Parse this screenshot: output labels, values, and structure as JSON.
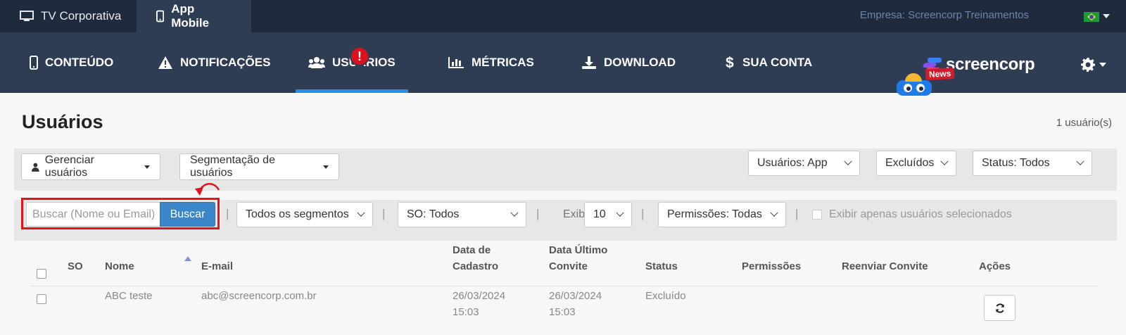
{
  "topbar": {
    "tabs": [
      {
        "label": "TV Corporativa",
        "icon": "monitor-icon"
      },
      {
        "label": "App Mobile",
        "icon": "mobile-icon",
        "active": true
      }
    ],
    "company": "Empresa: Screencorp Treinamentos",
    "language_flag": "brazil-flag-icon"
  },
  "nav": {
    "items": [
      {
        "label": "CONTEÚDO",
        "icon": "mobile-icon"
      },
      {
        "label": "NOTIFICAÇÕES",
        "icon": "warning-icon"
      },
      {
        "label": "USUÁRIOS",
        "icon": "users-icon",
        "active": true
      },
      {
        "label": "MÉTRICAS",
        "icon": "bar-chart-icon"
      },
      {
        "label": "DOWNLOAD",
        "icon": "download-icon"
      },
      {
        "label": "SUA CONTA",
        "icon": "dollar-icon"
      }
    ],
    "alert_badge": "!",
    "brand": "screencorp",
    "news_badge": "News",
    "settings_icon": "gear-icon"
  },
  "colors": {
    "topbar_bg": "#1f2a3d",
    "nav_bg": "#2f3d54",
    "active_underline": "#2690e8",
    "alert_red": "#d9121f",
    "search_button": "#3a86c8",
    "highlight_red": "#e0141a"
  },
  "page": {
    "title": "Usuários",
    "count": "1 usuário(s)"
  },
  "toolbar": {
    "manage_users": "Gerenciar usuários",
    "segmentation": "Segmentação de usuários",
    "users_filter": "Usuários: App",
    "excluded_filter": "Excluídos",
    "status_filter": "Status: Todos"
  },
  "filters": {
    "search_placeholder": "Buscar (Nome ou Email)",
    "search_button": "Buscar",
    "segments": "Todos os segmentos",
    "os": "SO: Todos",
    "show_label": "Exibir",
    "show_value": "10",
    "permissions": "Permissões: Todas",
    "only_selected": "Exibir apenas usuários selecionados",
    "separator": "|"
  },
  "table": {
    "headers": {
      "so": "SO",
      "name": "Nome",
      "email": "E-mail",
      "created_1": "Data de",
      "created_2": "Cadastro",
      "invite_1": "Data Último",
      "invite_2": "Convite",
      "status": "Status",
      "permissions": "Permissões",
      "resend": "Reenviar Convite",
      "actions": "Ações"
    },
    "rows": [
      {
        "so": "",
        "name": "ABC teste",
        "email": "abc@screencorp.com.br",
        "created_date": "26/03/2024",
        "created_time": "15:03",
        "invite_date": "26/03/2024",
        "invite_time": "15:03",
        "status": "Excluído",
        "permissions": "",
        "resend": "",
        "action_icon": "refresh-icon"
      }
    ]
  }
}
